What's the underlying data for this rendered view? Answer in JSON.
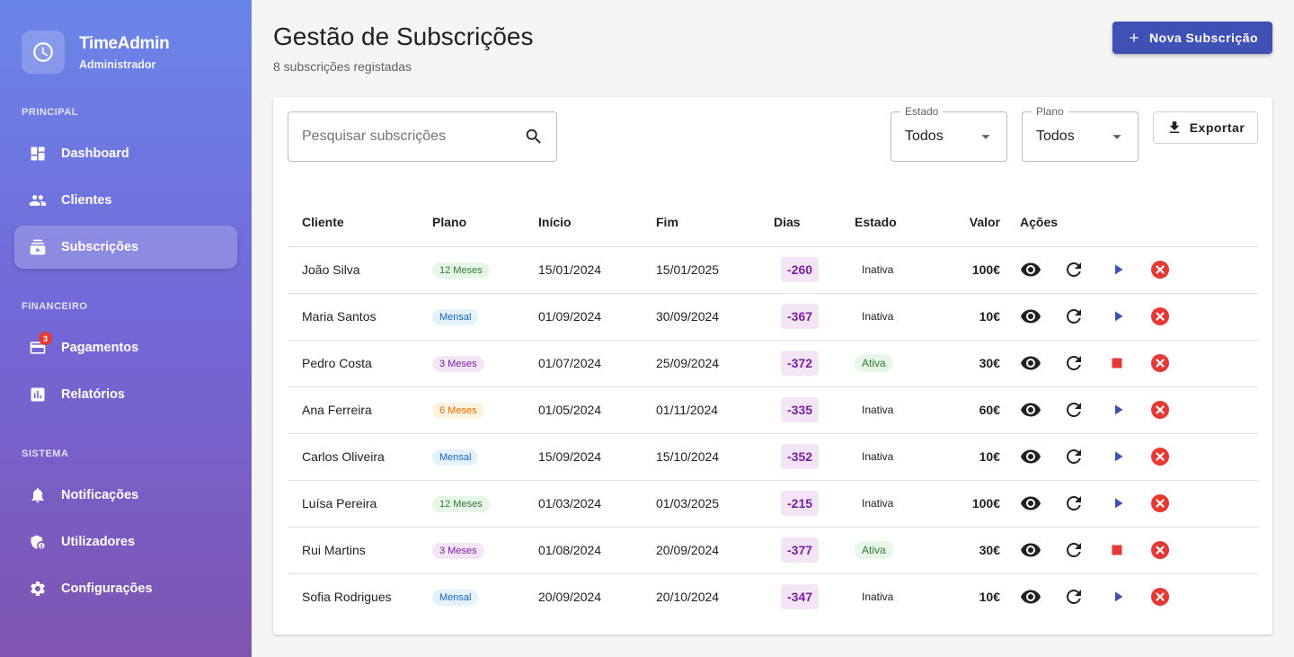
{
  "brand": {
    "name": "TimeAdmin",
    "role": "Administrador",
    "icon": "clock-icon"
  },
  "sidebar": {
    "sections": [
      {
        "label": "PRINCIPAL"
      },
      {
        "label": "FINANCEIRO"
      },
      {
        "label": "SISTEMA"
      }
    ],
    "items": [
      {
        "label": "Dashboard",
        "icon": "dashboard-icon"
      },
      {
        "label": "Clientes",
        "icon": "people-icon"
      },
      {
        "label": "Subscrições",
        "icon": "subscriptions-icon",
        "active": true
      },
      {
        "label": "Pagamentos",
        "icon": "card-icon",
        "badge": "3"
      },
      {
        "label": "Relatórios",
        "icon": "report-icon"
      },
      {
        "label": "Notificações",
        "icon": "bell-icon"
      },
      {
        "label": "Utilizadores",
        "icon": "admin-icon"
      },
      {
        "label": "Configurações",
        "icon": "gear-icon"
      }
    ]
  },
  "header": {
    "title": "Gestão de Subscrições",
    "subtitle": "8 subscrições registadas",
    "new_label": "Nova Subscrição"
  },
  "filters": {
    "search_placeholder": "Pesquisar subscrições",
    "estado_label": "Estado",
    "estado_value": "Todos",
    "plano_label": "Plano",
    "plano_value": "Todos",
    "export_label": "Exportar"
  },
  "table": {
    "columns": [
      "Cliente",
      "Plano",
      "Início",
      "Fim",
      "Dias",
      "Estado",
      "Valor",
      "Ações"
    ],
    "rows": [
      {
        "cliente": "João Silva",
        "plano": "12 Meses",
        "inicio": "15/01/2024",
        "fim": "15/01/2025",
        "dias": "-260",
        "estado": "Inativa",
        "valor": "100€"
      },
      {
        "cliente": "Maria Santos",
        "plano": "Mensal",
        "inicio": "01/09/2024",
        "fim": "30/09/2024",
        "dias": "-367",
        "estado": "Inativa",
        "valor": "10€"
      },
      {
        "cliente": "Pedro Costa",
        "plano": "3 Meses",
        "inicio": "01/07/2024",
        "fim": "25/09/2024",
        "dias": "-372",
        "estado": "Ativa",
        "valor": "30€"
      },
      {
        "cliente": "Ana Ferreira",
        "plano": "6 Meses",
        "inicio": "01/05/2024",
        "fim": "01/11/2024",
        "dias": "-335",
        "estado": "Inativa",
        "valor": "60€"
      },
      {
        "cliente": "Carlos Oliveira",
        "plano": "Mensal",
        "inicio": "15/09/2024",
        "fim": "15/10/2024",
        "dias": "-352",
        "estado": "Inativa",
        "valor": "10€"
      },
      {
        "cliente": "Luísa Pereira",
        "plano": "12 Meses",
        "inicio": "01/03/2024",
        "fim": "01/03/2025",
        "dias": "-215",
        "estado": "Inativa",
        "valor": "100€"
      },
      {
        "cliente": "Rui Martins",
        "plano": "3 Meses",
        "inicio": "01/08/2024",
        "fim": "20/09/2024",
        "dias": "-377",
        "estado": "Ativa",
        "valor": "30€"
      },
      {
        "cliente": "Sofia Rodrigues",
        "plano": "Mensal",
        "inicio": "20/09/2024",
        "fim": "20/10/2024",
        "dias": "-347",
        "estado": "Inativa",
        "valor": "10€"
      }
    ]
  },
  "colors": {
    "primary": "#3f51b5",
    "sidebar_top": "#6a85e8",
    "sidebar_bottom": "#7f54b1",
    "danger": "#e53935",
    "days": "#7b1fa2",
    "active_state": "#2e7d32"
  }
}
